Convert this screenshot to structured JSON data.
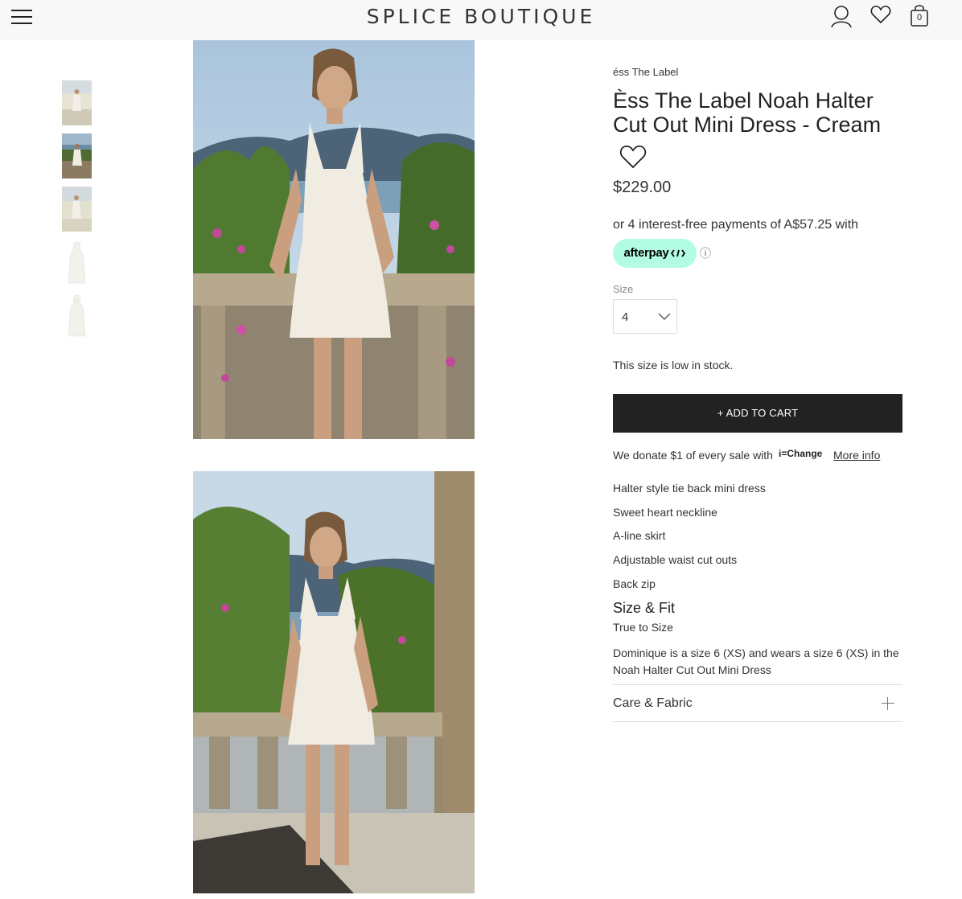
{
  "header": {
    "brand": "SPLICE BOUTIQUE",
    "bag_count": "0",
    "icons": [
      "menu-icon",
      "account-icon",
      "wishlist-icon",
      "bag-icon"
    ]
  },
  "product": {
    "vendor": "éss The Label",
    "title": "Èss The Label Noah Halter Cut Out Mini Dress - Cream",
    "price": "$229.00",
    "afterpay_text": "or 4 interest-free payments of A$57.25 with",
    "afterpay_logo": "afterpay",
    "afterpay_info": "ⓘ",
    "size_label": "Size",
    "size_selected": "4",
    "stock_message": "This size is low in stock.",
    "add_to_cart": "+ ADD TO CART",
    "donate_text": "We donate $1 of every sale with",
    "donate_partner": "i=Change",
    "more_info": "More info",
    "features": [
      "Halter style tie back mini dress",
      "Sweet heart neckline",
      "A-line skirt",
      "Adjustable waist cut outs",
      "Back zip"
    ],
    "size_fit": {
      "title": "Size & Fit",
      "lines": [
        "True to Size",
        "Dominique is a size 6 (XS) and wears a size 6 (XS) in the Noah Halter Cut Out Mini Dress"
      ]
    },
    "care_fabric": "Care & Fabric"
  },
  "colors": {
    "header_bg": "#f8f8f8",
    "button_bg": "#222222",
    "afterpay_mint": "#b2fce4",
    "dress_cream": "#f1ece2"
  }
}
